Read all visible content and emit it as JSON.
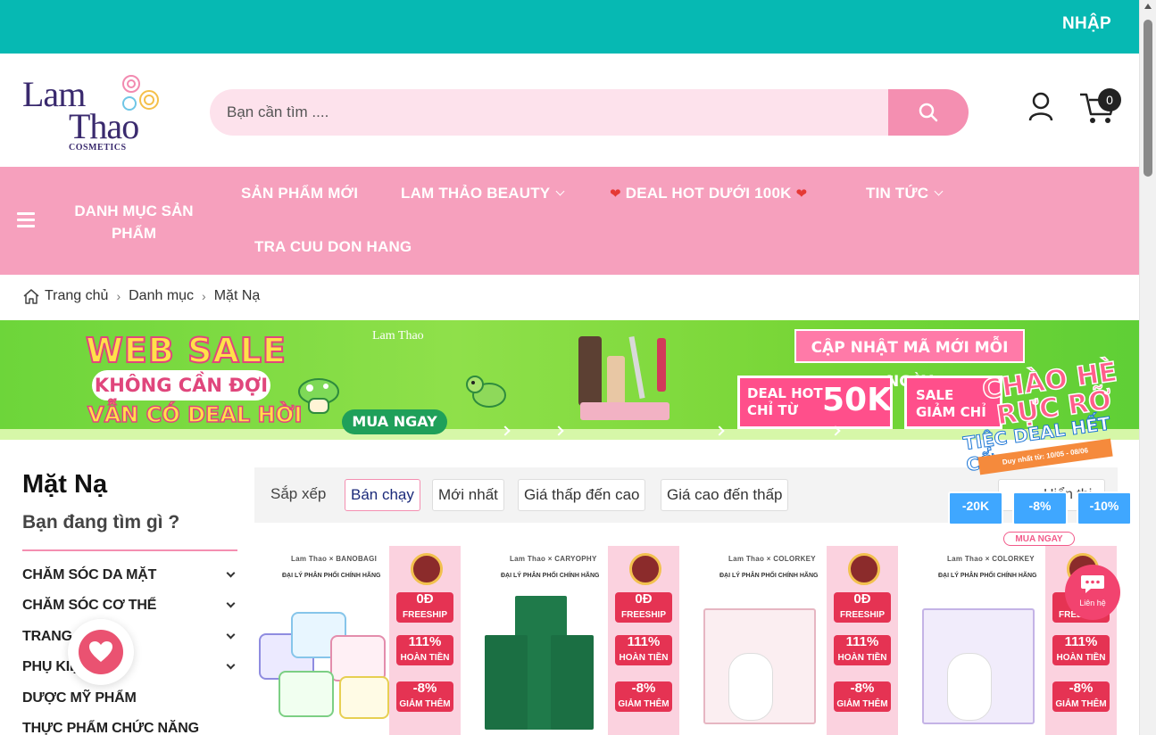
{
  "topbar": {
    "login": "NHẬP"
  },
  "logo": {
    "line1": "Lam",
    "line2": "Thao",
    "line3": "COSMETICS"
  },
  "search": {
    "placeholder": "Bạn cần tìm ...."
  },
  "cart": {
    "count": "0"
  },
  "nav": {
    "category_label": "DANH MỤC SẢN PHẨM",
    "items": [
      {
        "label": "SẢN PHẨM MỚI"
      },
      {
        "label": "LAM THẢO BEAUTY"
      },
      {
        "label": "DEAL HOT DƯỚI 100K"
      },
      {
        "label": "TIN TỨC"
      },
      {
        "label": "TRA CUU DON HANG"
      }
    ]
  },
  "breadcrumb": [
    "Trang chủ",
    "Danh mục",
    "Mặt Nạ"
  ],
  "banner": {
    "title": "WEB SALE",
    "pill": "KHÔNG CẦN ĐỢI",
    "tagline": "VẪN CÓ DEAL HỜI",
    "logo": "Lam Thao",
    "buy": "MUA NGAY",
    "update": "CẬP NHẬT MÃ MỚI MỖI NGÀY",
    "deal_line1": "DEAL HOT",
    "deal_line2": "CHỈ TỪ",
    "deal_price": "50K",
    "sale_line1": "SALE",
    "sale_line2": "GIẢM CHỈ"
  },
  "summer_promo": {
    "line1": "CHÀO HÈ",
    "line2": "RỰC RỠ",
    "line3": "TIỆC DEAL HẾT CỠ",
    "ribbon": "Duy nhất từ: 10/05 - 08/06",
    "vouchers": [
      "-20K",
      "-8%",
      "-10%"
    ],
    "buy": "MUA NGAY"
  },
  "sidebar": {
    "title": "Mặt Nạ",
    "subtitle": "Bạn đang tìm gì ?",
    "categories": [
      {
        "label": "CHĂM SÓC DA MẶT"
      },
      {
        "label": "CHĂM SÓC CƠ THỂ"
      },
      {
        "label": "TRANG ĐIỂM"
      },
      {
        "label": "PHỤ KIỆN"
      },
      {
        "label": "DƯỢC MỸ PHẨM"
      },
      {
        "label": "THỰC PHẨM CHỨC NĂNG"
      }
    ]
  },
  "sort": {
    "label": "Sắp xếp",
    "options": [
      "Bán chạy",
      "Mới nhất",
      "Giá thấp đến cao",
      "Giá cao đến thấp"
    ],
    "show": "Hiển thị 20"
  },
  "products": [
    {
      "brand": "Lam Thao × BANOBAGI",
      "dist": "ĐẠI LÝ PHÂN PHỐI CHÍNH HÃNG"
    },
    {
      "brand": "Lam Thao × CARYOPHY",
      "dist": "ĐẠI LÝ PHÂN PHỐI CHÍNH HÃNG"
    },
    {
      "brand": "Lam Thao × COLORKEY",
      "dist": "ĐẠI LÝ PHÂN PHỐI CHÍNH HÃNG"
    },
    {
      "brand": "Lam Thao × COLORKEY",
      "dist": "ĐẠI LÝ PHÂN PHỐI CHÍNH HÃNG"
    }
  ],
  "promo_tags": {
    "freeship": "0Đ",
    "freeship_label": "FREESHIP",
    "refund": "111%",
    "refund_label": "HOÀN TIỀN",
    "discount": "-8%",
    "discount_label": "GIẢM THÊM"
  },
  "contact": {
    "label": "Liên hệ"
  },
  "colors": {
    "teal": "#06b9b3",
    "pink": "#f6a0bd",
    "accent": "#f48fb1"
  }
}
